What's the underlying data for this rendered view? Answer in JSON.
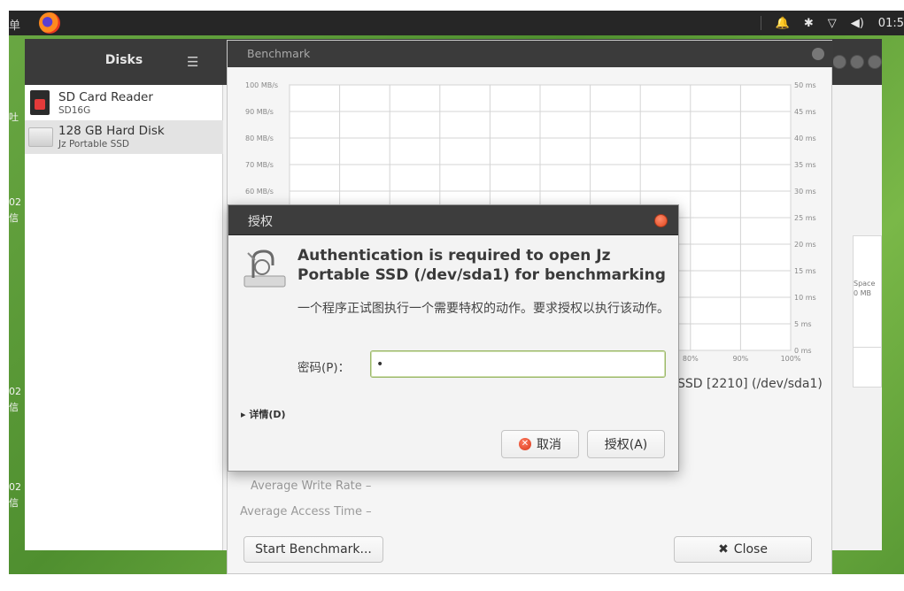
{
  "topbar": {
    "left_text": "单",
    "tray": [
      "🔔",
      "✱",
      "▽",
      "◀︎)",
      "01:5"
    ]
  },
  "desktop_icons": [
    "吐",
    "02",
    "信",
    "02",
    "信",
    "02",
    "信"
  ],
  "disks_window": {
    "title": "Disks",
    "devices": [
      {
        "name": "SD Card Reader",
        "sub": "SD16G",
        "icon": "sd-card-icon"
      },
      {
        "name": "128 GB Hard Disk",
        "sub": "Jz Portable SSD",
        "icon": "hard-disk-icon"
      }
    ],
    "side_strip_text": [
      "Space",
      "0 MB"
    ]
  },
  "benchmark_window": {
    "title": "Benchmark",
    "drive_label": "SSD [2210] (/dev/sda1)",
    "stats": [
      {
        "label": "Average Write Rate",
        "value": "–"
      },
      {
        "label": "Average Access Time",
        "value": "–"
      }
    ],
    "start_button": "Start Benchmark...",
    "close_button": "Close"
  },
  "chart_data": {
    "type": "line",
    "title": "",
    "left_axis": {
      "label": "",
      "unit": "MB/s",
      "range": [
        0,
        100
      ],
      "ticks": [
        "100 MB/s",
        "90 MB/s",
        "80 MB/s",
        "70 MB/s",
        "60 MB/s"
      ]
    },
    "right_axis": {
      "label": "",
      "unit": "ms",
      "range": [
        0,
        50
      ],
      "ticks": [
        "50 ms",
        "45 ms",
        "40 ms",
        "35 ms",
        "30 ms",
        "25 ms",
        "20 ms",
        "15 ms",
        "10 ms",
        "5 ms",
        "0 ms"
      ]
    },
    "x_axis": {
      "ticks": [
        "80%",
        "90%",
        "100%"
      ]
    },
    "grid": true,
    "series": []
  },
  "auth_dialog": {
    "title": "授权",
    "heading": "Authentication is required to open Jz Portable SSD (/dev/sda1) for benchmarking",
    "description": "一个程序正试图执行一个需要特权的动作。要求授权以执行该动作。",
    "password_label": "密码(P)：",
    "password_value": "•",
    "details_label": "▸ 详情(D)",
    "cancel_button": "取消",
    "auth_button": "授权(A)"
  }
}
